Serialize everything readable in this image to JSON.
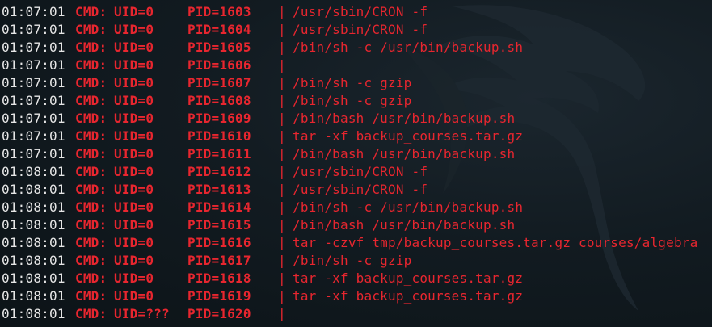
{
  "terminal": {
    "cmd_label": "CMD:",
    "separator": "|",
    "lines": [
      {
        "time": "01:07:01",
        "uid": "UID=0",
        "pid": "PID=1603",
        "command": "/usr/sbin/CRON -f"
      },
      {
        "time": "01:07:01",
        "uid": "UID=0",
        "pid": "PID=1604",
        "command": "/usr/sbin/CRON -f"
      },
      {
        "time": "01:07:01",
        "uid": "UID=0",
        "pid": "PID=1605",
        "command": "/bin/sh -c /usr/bin/backup.sh"
      },
      {
        "time": "01:07:01",
        "uid": "UID=0",
        "pid": "PID=1606",
        "command": ""
      },
      {
        "time": "01:07:01",
        "uid": "UID=0",
        "pid": "PID=1607",
        "command": "/bin/sh -c gzip"
      },
      {
        "time": "01:07:01",
        "uid": "UID=0",
        "pid": "PID=1608",
        "command": "/bin/sh -c gzip"
      },
      {
        "time": "01:07:01",
        "uid": "UID=0",
        "pid": "PID=1609",
        "command": "/bin/bash /usr/bin/backup.sh"
      },
      {
        "time": "01:07:01",
        "uid": "UID=0",
        "pid": "PID=1610",
        "command": "tar -xf backup_courses.tar.gz"
      },
      {
        "time": "01:07:01",
        "uid": "UID=0",
        "pid": "PID=1611",
        "command": "/bin/bash /usr/bin/backup.sh"
      },
      {
        "time": "01:08:01",
        "uid": "UID=0",
        "pid": "PID=1612",
        "command": "/usr/sbin/CRON -f"
      },
      {
        "time": "01:08:01",
        "uid": "UID=0",
        "pid": "PID=1613",
        "command": "/usr/sbin/CRON -f"
      },
      {
        "time": "01:08:01",
        "uid": "UID=0",
        "pid": "PID=1614",
        "command": "/bin/sh -c /usr/bin/backup.sh"
      },
      {
        "time": "01:08:01",
        "uid": "UID=0",
        "pid": "PID=1615",
        "command": "/bin/bash /usr/bin/backup.sh"
      },
      {
        "time": "01:08:01",
        "uid": "UID=0",
        "pid": "PID=1616",
        "command": "tar -czvf tmp/backup_courses.tar.gz courses/algebra"
      },
      {
        "time": "01:08:01",
        "uid": "UID=0",
        "pid": "PID=1617",
        "command": "/bin/sh -c gzip"
      },
      {
        "time": "01:08:01",
        "uid": "UID=0",
        "pid": "PID=1618",
        "command": "tar -xf backup_courses.tar.gz"
      },
      {
        "time": "01:08:01",
        "uid": "UID=0",
        "pid": "PID=1619",
        "command": "tar -xf backup_courses.tar.gz"
      },
      {
        "time": "01:08:01",
        "uid": "UID=???",
        "pid": "PID=1620",
        "command": ""
      }
    ]
  },
  "colors": {
    "background": "#121b21",
    "timestamp": "#e6e6e6",
    "accent_red": "#e8262f",
    "watermark": "#26323a"
  },
  "background_icon": "kali-dragon-watermark"
}
